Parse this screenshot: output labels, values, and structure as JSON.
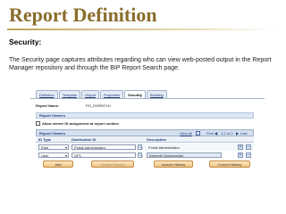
{
  "slide": {
    "title": "Report Definition",
    "section_heading": "Security:",
    "description": "The Security page captures attributes regarding who can view web-posted output in the Report Manager repository and through the BIP Report Search page."
  },
  "app": {
    "tabs": [
      {
        "label": "Definition",
        "active": false
      },
      {
        "label": "Template",
        "active": false
      },
      {
        "label": "Output",
        "active": false
      },
      {
        "label": "Properties",
        "active": false
      },
      {
        "label": "Security",
        "active": true
      },
      {
        "label": "Bursting",
        "active": false
      }
    ],
    "report_name_label": "Report Name:",
    "report_name_value": "PO_DISPATCH",
    "panel_title": "Report Viewers",
    "checkbox_label": "Allow viewer ID assignment at report runtime",
    "grid": {
      "title": "Report Viewers",
      "view_all": "View All",
      "first": "First",
      "pager": "1-2 of 2",
      "last": "Last",
      "columns": [
        "ID Type",
        "Distribution ID",
        "Description"
      ],
      "rows": [
        {
          "id_type": "Role",
          "distribution_id": "Portal Administrator",
          "description": "Portal Administrator"
        },
        {
          "id_type": "User",
          "distribution_id": "OP1",
          "description": "Kenneth Schumacher"
        }
      ],
      "add_row": "+",
      "delete_row": "−"
    },
    "buttons": {
      "add": "Add",
      "update_display": "Update/Display",
      "include_history": "Include History",
      "correct_history": "Correct History"
    }
  }
}
